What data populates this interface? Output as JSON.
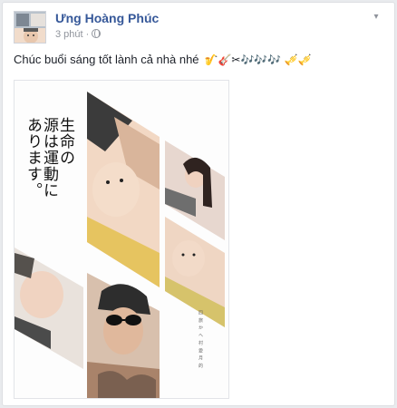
{
  "post": {
    "author": "Ưng Hoàng Phúc",
    "time": "3 phút",
    "privacy_icon": "globe-icon",
    "menu_icon": "chevron-down-icon",
    "caption": "Chúc buổi sáng tốt lành cả nhà nhé",
    "caption_emoji": "🎷🎸✂🎶🎶🎶 🎺🎺"
  },
  "photo": {
    "jp_line_1": "生命の",
    "jp_line_2": "源は運動に",
    "jp_line_3": "あります。",
    "small_vertical_text": "四 旅 か へ 村 愛 月 的"
  },
  "colors": {
    "author": "#365899",
    "meta": "#90949c",
    "text": "#1d2129",
    "background": "#e9ebee",
    "card": "#ffffff"
  }
}
